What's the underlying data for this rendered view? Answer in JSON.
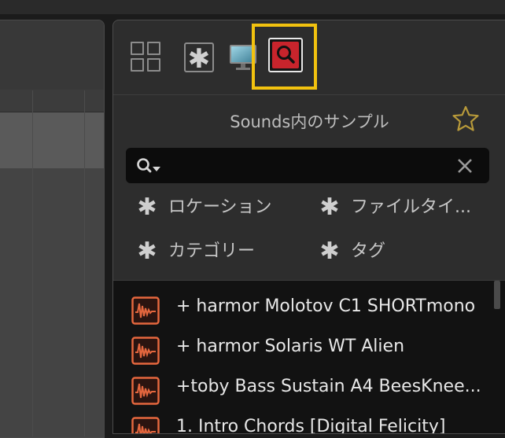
{
  "browser": {
    "tabs": [
      {
        "icon": "grid-icon"
      },
      {
        "icon": "asterisk-icon"
      },
      {
        "icon": "monitor-icon"
      },
      {
        "icon": "search-icon",
        "active": true
      }
    ],
    "title": "Sounds内のサンプル",
    "search": {
      "value": "",
      "placeholder": ""
    },
    "filters": [
      {
        "label": "ロケーション"
      },
      {
        "label": "ファイルタイ..."
      },
      {
        "label": "カテゴリー"
      },
      {
        "label": "タグ"
      }
    ],
    "results": [
      {
        "name": "+ harmor Molotov C1 SHORTmono"
      },
      {
        "name": "+ harmor Solaris WT Alien"
      },
      {
        "name": "+toby Bass Sustain A4 BeesKnee..."
      },
      {
        "name": "1. Intro Chords [Digital Felicity]"
      }
    ],
    "highlight_color": "#f2c20f",
    "accent_color": "#c8242c",
    "result_icon_color": "#e5673e"
  }
}
